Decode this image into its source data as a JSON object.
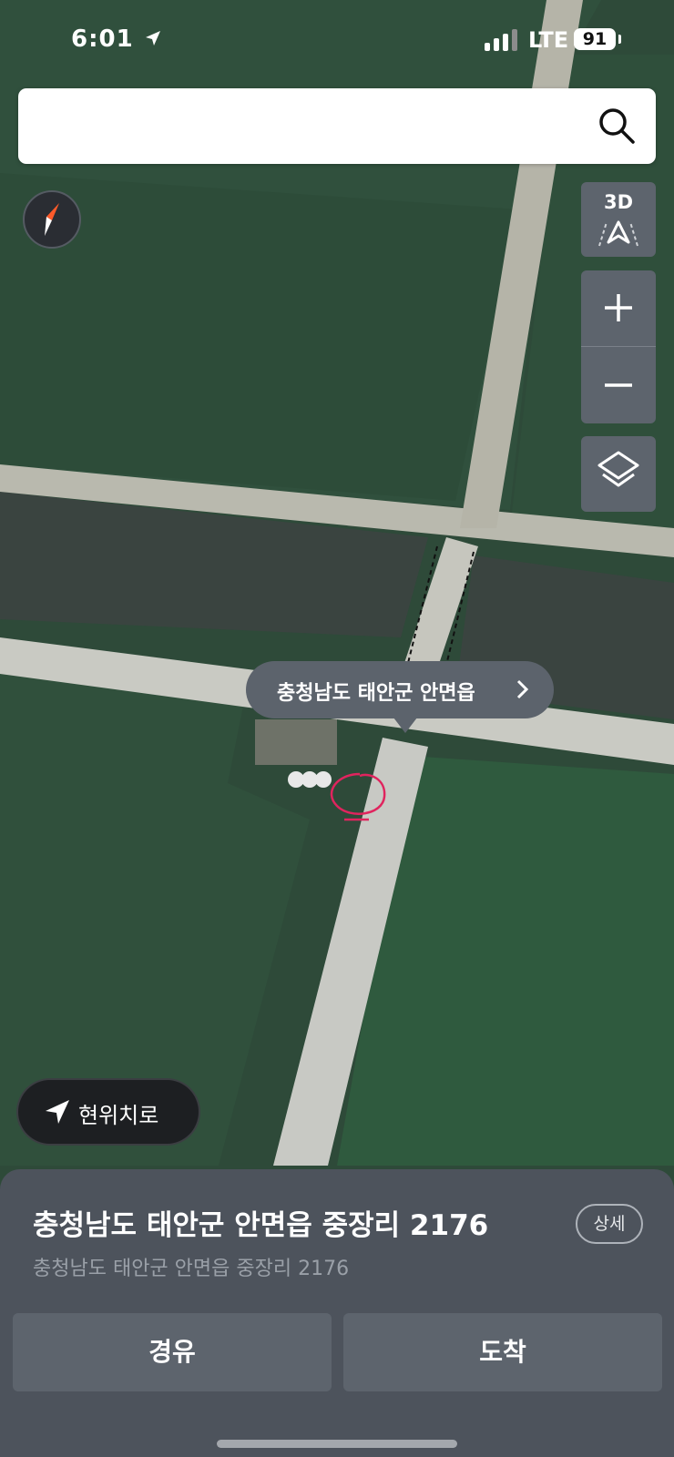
{
  "status_bar": {
    "time": "6:01",
    "network": "LTE",
    "battery": "91"
  },
  "search": {
    "placeholder": "",
    "icon": "search-icon"
  },
  "map_controls": {
    "compass_icon": "compass-icon",
    "view_3d_label": "3D",
    "zoom_in_icon": "plus-icon",
    "zoom_out_icon": "minus-icon",
    "layers_icon": "layers-icon"
  },
  "location_callout": {
    "label": "충청남도 태안군 안면읍"
  },
  "current_location": {
    "label": "현위치로"
  },
  "place_sheet": {
    "title": "충청남도 태안군 안면읍 중장리 2176",
    "subtitle": "충청남도 태안군 안면읍 중장리 2176",
    "detail_label": "상세",
    "waypoint_label": "경유",
    "arrive_label": "도착"
  },
  "colors": {
    "field": "#2f4e3c",
    "road": "#c7c9c3",
    "panel": "#4d535c",
    "button": "#5d646d",
    "marker": "#e0245e"
  }
}
